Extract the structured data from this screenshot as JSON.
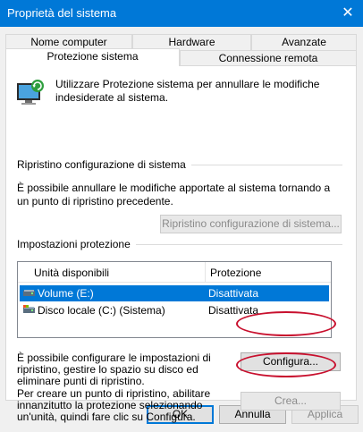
{
  "window": {
    "title": "Proprietà del sistema",
    "close_glyph": "✕"
  },
  "tabs": {
    "row1": [
      "Nome computer",
      "Hardware",
      "Avanzate"
    ],
    "row2": [
      "Protezione sistema",
      "Connessione remota"
    ],
    "active": "Protezione sistema"
  },
  "intro": {
    "text": "Utilizzare Protezione sistema per annullare le modifiche indesiderate al sistema.",
    "icon": "system-protection-icon"
  },
  "restore": {
    "group_title": "Ripristino configurazione di sistema",
    "description": "È possibile annullare le modifiche apportate al sistema tornando a un punto di ripristino precedente.",
    "button_label": "Ripristino configurazione di sistema..."
  },
  "protection": {
    "group_title": "Impostazioni protezione",
    "columns": [
      "Unità disponibili",
      "Protezione"
    ],
    "drives": [
      {
        "name": "Volume (E:)",
        "status": "Disattivata",
        "selected": true,
        "icon": "drive-icon"
      },
      {
        "name": "Disco locale (C:) (Sistema)",
        "status": "Disattivata",
        "selected": false,
        "icon": "system-drive-icon"
      }
    ],
    "configure_text": "È possibile configurare le impostazioni di ripristino, gestire lo spazio su disco ed eliminare punti di ripristino.",
    "configure_button": "Configura...",
    "create_text": "Per creare un punto di ripristino, abilitare innanzitutto la protezione selezionando un'unità, quindi fare clic su Configura.",
    "create_button": "Crea..."
  },
  "footer": {
    "ok": "OK",
    "cancel": "Annulla",
    "apply": "Applica"
  },
  "colors": {
    "accent": "#0078d7",
    "annotation": "#c8102e"
  }
}
